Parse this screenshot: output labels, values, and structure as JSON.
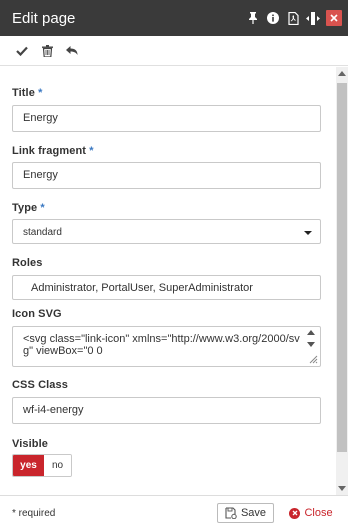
{
  "window": {
    "title": "Edit page",
    "accent_color": "#c9252c",
    "titlebar_color": "#3a3a3a",
    "titlebar_icons": [
      "pin-icon",
      "info-icon",
      "pdf-icon",
      "expand-width-icon",
      "close-icon"
    ]
  },
  "toolbar": {
    "icons": [
      "checkmark-icon",
      "trash-icon",
      "undo-icon"
    ]
  },
  "form": {
    "title": {
      "label": "Title",
      "required_mark": "*",
      "value": "Energy"
    },
    "link_fragment": {
      "label": "Link fragment",
      "required_mark": "*",
      "value": "Energy"
    },
    "type": {
      "label": "Type",
      "required_mark": "*",
      "selected": "standard"
    },
    "roles": {
      "label": "Roles",
      "value": "Administrator, PortalUser, SuperAdministrator"
    },
    "icon_svg": {
      "label": "Icon SVG",
      "value": "<svg class=\"link-icon\" xmlns=\"http://www.w3.org/2000/svg\" viewBox=\"0 0"
    },
    "css_class": {
      "label": "CSS Class",
      "value": "wf-i4-energy"
    },
    "visible": {
      "label": "Visible",
      "yes_label": "yes",
      "no_label": "no",
      "selected": "yes"
    }
  },
  "footer": {
    "required_note": "* required",
    "save_label": "Save",
    "close_label": "Close"
  }
}
